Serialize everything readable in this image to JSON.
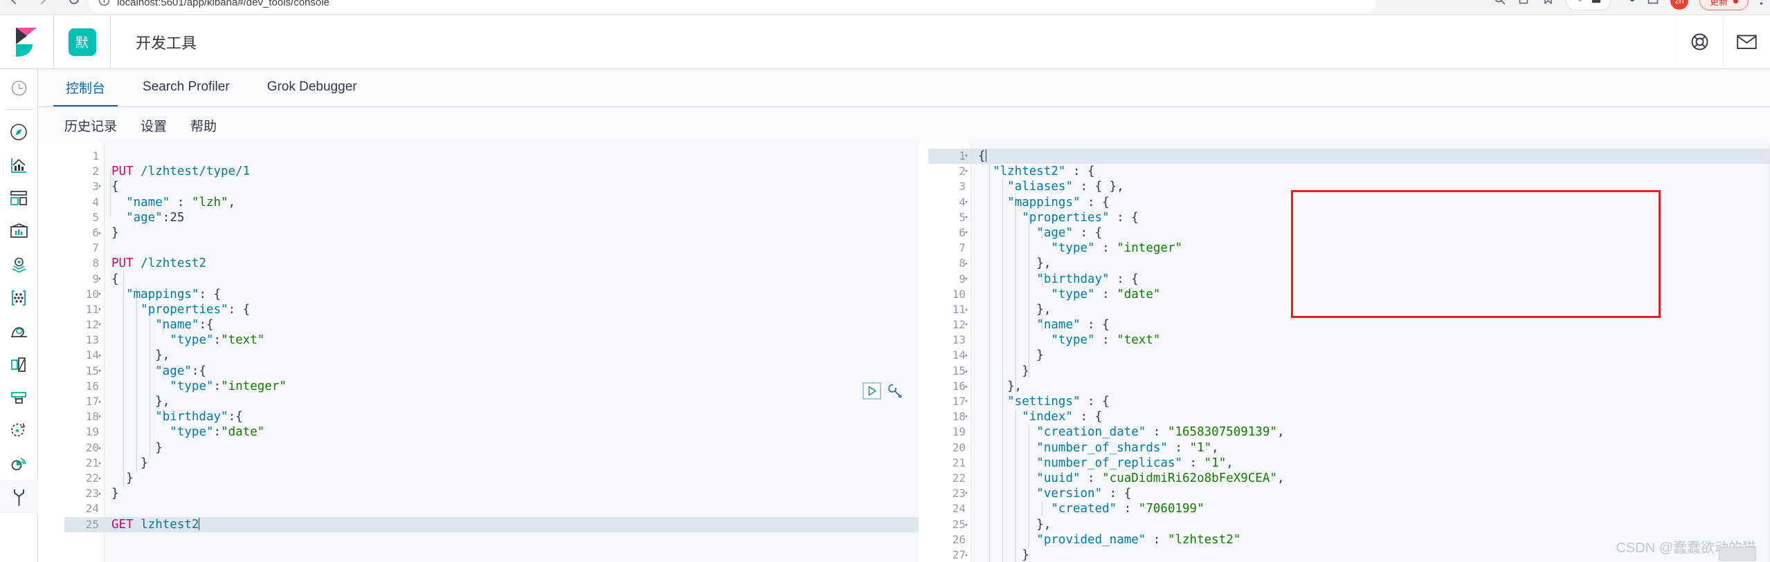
{
  "browser": {
    "url": "localhost:5601/app/kibana#/dev_tools/console",
    "update_label": "更新",
    "profile_initials": "zh",
    "icons": {
      "back": "back-arrow-icon",
      "forward": "forward-arrow-icon",
      "reload": "reload-icon",
      "info": "site-info-icon",
      "search": "search-icon",
      "share": "share-icon",
      "bookmark": "bookmark-icon",
      "download": "download-icon",
      "home": "home-icon",
      "extensions": "extensions-icon",
      "window": "window-icon"
    }
  },
  "kibana": {
    "logo": "kibana-logo",
    "space_badge": "默",
    "app_title": "开发工具",
    "header_icons": [
      "help-ring-icon",
      "mail-icon"
    ]
  },
  "rail": {
    "items": [
      {
        "name": "recently-viewed",
        "icon": "clock-icon",
        "active": false
      },
      {
        "name": "discover",
        "icon": "compass-icon",
        "active": false
      },
      {
        "name": "visualize",
        "icon": "bar-chart-icon",
        "active": false
      },
      {
        "name": "dashboard",
        "icon": "dashboard-icon",
        "active": false
      },
      {
        "name": "canvas",
        "icon": "canvas-icon",
        "active": false
      },
      {
        "name": "maps",
        "icon": "map-pin-layers-icon",
        "active": false
      },
      {
        "name": "graph",
        "icon": "graph-nodes-icon",
        "active": false
      },
      {
        "name": "machine-learning",
        "icon": "machine-learning-icon",
        "active": false
      },
      {
        "name": "apm",
        "icon": "apm-icon",
        "active": false
      },
      {
        "name": "uptime",
        "icon": "uptime-icon",
        "active": false
      },
      {
        "name": "siem",
        "icon": "siem-icon",
        "active": false
      },
      {
        "name": "monitoring",
        "icon": "monitoring-icon",
        "active": false
      },
      {
        "name": "dev-tools",
        "icon": "wrench-icon",
        "active": true
      }
    ]
  },
  "tabs": [
    {
      "label": "控制台",
      "active": true
    },
    {
      "label": "Search Profiler",
      "active": false
    },
    {
      "label": "Grok Debugger",
      "active": false
    }
  ],
  "subbar": [
    {
      "label": "历史记录"
    },
    {
      "label": "设置"
    },
    {
      "label": "帮助"
    }
  ],
  "editor": {
    "current_line": 25,
    "lines": [
      {
        "n": 1,
        "fold": "",
        "tokens": []
      },
      {
        "n": 2,
        "fold": "",
        "tokens": [
          {
            "t": "method",
            "v": "PUT"
          },
          {
            "t": "punct",
            "v": " "
          },
          {
            "t": "url",
            "v": "/lzhtest/type/1"
          }
        ]
      },
      {
        "n": 3,
        "fold": "▾",
        "tokens": [
          {
            "t": "punct",
            "v": "{"
          }
        ]
      },
      {
        "n": 4,
        "fold": "",
        "tokens": [
          {
            "t": "punct",
            "v": "  "
          },
          {
            "t": "key",
            "v": "\"name\""
          },
          {
            "t": "punct",
            "v": " : "
          },
          {
            "t": "str",
            "v": "\"lzh\""
          },
          {
            "t": "punct",
            "v": ","
          }
        ]
      },
      {
        "n": 5,
        "fold": "",
        "tokens": [
          {
            "t": "punct",
            "v": "  "
          },
          {
            "t": "key",
            "v": "\"age\""
          },
          {
            "t": "punct",
            "v": ":"
          },
          {
            "t": "num",
            "v": "25"
          }
        ]
      },
      {
        "n": 6,
        "fold": "▴",
        "tokens": [
          {
            "t": "punct",
            "v": "}"
          }
        ]
      },
      {
        "n": 7,
        "fold": "",
        "tokens": []
      },
      {
        "n": 8,
        "fold": "",
        "tokens": [
          {
            "t": "method",
            "v": "PUT"
          },
          {
            "t": "punct",
            "v": " "
          },
          {
            "t": "url",
            "v": "/lzhtest2"
          }
        ]
      },
      {
        "n": 9,
        "fold": "▾",
        "tokens": [
          {
            "t": "punct",
            "v": "{"
          }
        ]
      },
      {
        "n": 10,
        "fold": "▾",
        "tokens": [
          {
            "t": "punct",
            "v": "  "
          },
          {
            "t": "key",
            "v": "\"mappings\""
          },
          {
            "t": "punct",
            "v": ": {"
          }
        ]
      },
      {
        "n": 11,
        "fold": "▾",
        "tokens": [
          {
            "t": "punct",
            "v": "    "
          },
          {
            "t": "key",
            "v": "\"properties\""
          },
          {
            "t": "punct",
            "v": ": {"
          }
        ]
      },
      {
        "n": 12,
        "fold": "▾",
        "tokens": [
          {
            "t": "punct",
            "v": "      "
          },
          {
            "t": "key",
            "v": "\"name\""
          },
          {
            "t": "punct",
            "v": ":{"
          }
        ]
      },
      {
        "n": 13,
        "fold": "",
        "tokens": [
          {
            "t": "punct",
            "v": "        "
          },
          {
            "t": "key",
            "v": "\"type\""
          },
          {
            "t": "punct",
            "v": ":"
          },
          {
            "t": "str",
            "v": "\"text\""
          }
        ]
      },
      {
        "n": 14,
        "fold": "▴",
        "tokens": [
          {
            "t": "punct",
            "v": "      },"
          }
        ]
      },
      {
        "n": 15,
        "fold": "▾",
        "tokens": [
          {
            "t": "punct",
            "v": "      "
          },
          {
            "t": "key",
            "v": "\"age\""
          },
          {
            "t": "punct",
            "v": ":{"
          }
        ]
      },
      {
        "n": 16,
        "fold": "",
        "tokens": [
          {
            "t": "punct",
            "v": "        "
          },
          {
            "t": "key",
            "v": "\"type\""
          },
          {
            "t": "punct",
            "v": ":"
          },
          {
            "t": "str",
            "v": "\"integer\""
          }
        ]
      },
      {
        "n": 17,
        "fold": "▴",
        "tokens": [
          {
            "t": "punct",
            "v": "      },"
          }
        ]
      },
      {
        "n": 18,
        "fold": "▾",
        "tokens": [
          {
            "t": "punct",
            "v": "      "
          },
          {
            "t": "key",
            "v": "\"birthday\""
          },
          {
            "t": "punct",
            "v": ":{"
          }
        ]
      },
      {
        "n": 19,
        "fold": "",
        "tokens": [
          {
            "t": "punct",
            "v": "        "
          },
          {
            "t": "key",
            "v": "\"type\""
          },
          {
            "t": "punct",
            "v": ":"
          },
          {
            "t": "str",
            "v": "\"date\""
          }
        ]
      },
      {
        "n": 20,
        "fold": "▴",
        "tokens": [
          {
            "t": "punct",
            "v": "      }"
          }
        ]
      },
      {
        "n": 21,
        "fold": "▴",
        "tokens": [
          {
            "t": "punct",
            "v": "    }"
          }
        ]
      },
      {
        "n": 22,
        "fold": "▴",
        "tokens": [
          {
            "t": "punct",
            "v": "  }"
          }
        ]
      },
      {
        "n": 23,
        "fold": "▴",
        "tokens": [
          {
            "t": "punct",
            "v": "}"
          }
        ]
      },
      {
        "n": 24,
        "fold": "",
        "tokens": []
      },
      {
        "n": 25,
        "fold": "",
        "tokens": [
          {
            "t": "method",
            "v": "GET"
          },
          {
            "t": "punct",
            "v": " "
          },
          {
            "t": "url",
            "v": "lzhtest2"
          }
        ],
        "cursor": true
      }
    ]
  },
  "response": {
    "current_line": 1,
    "lines": [
      {
        "n": 1,
        "fold": "▾",
        "tokens": [
          {
            "t": "punct",
            "v": "{"
          }
        ],
        "cursor": true
      },
      {
        "n": 2,
        "fold": "▾",
        "tokens": [
          {
            "t": "punct",
            "v": "  "
          },
          {
            "t": "key",
            "v": "\"lzhtest2\""
          },
          {
            "t": "punct",
            "v": " : {"
          }
        ]
      },
      {
        "n": 3,
        "fold": "",
        "tokens": [
          {
            "t": "punct",
            "v": "    "
          },
          {
            "t": "key",
            "v": "\"aliases\""
          },
          {
            "t": "punct",
            "v": " : { },"
          }
        ]
      },
      {
        "n": 4,
        "fold": "▾",
        "tokens": [
          {
            "t": "punct",
            "v": "    "
          },
          {
            "t": "key",
            "v": "\"mappings\""
          },
          {
            "t": "punct",
            "v": " : {"
          }
        ]
      },
      {
        "n": 5,
        "fold": "▾",
        "tokens": [
          {
            "t": "punct",
            "v": "      "
          },
          {
            "t": "key",
            "v": "\"properties\""
          },
          {
            "t": "punct",
            "v": " : {"
          }
        ]
      },
      {
        "n": 6,
        "fold": "▾",
        "tokens": [
          {
            "t": "punct",
            "v": "        "
          },
          {
            "t": "key",
            "v": "\"age\""
          },
          {
            "t": "punct",
            "v": " : {"
          }
        ]
      },
      {
        "n": 7,
        "fold": "",
        "tokens": [
          {
            "t": "punct",
            "v": "          "
          },
          {
            "t": "key",
            "v": "\"type\""
          },
          {
            "t": "punct",
            "v": " : "
          },
          {
            "t": "str",
            "v": "\"integer\""
          }
        ]
      },
      {
        "n": 8,
        "fold": "▴",
        "tokens": [
          {
            "t": "punct",
            "v": "        },"
          }
        ]
      },
      {
        "n": 9,
        "fold": "▾",
        "tokens": [
          {
            "t": "punct",
            "v": "        "
          },
          {
            "t": "key",
            "v": "\"birthday\""
          },
          {
            "t": "punct",
            "v": " : {"
          }
        ]
      },
      {
        "n": 10,
        "fold": "",
        "tokens": [
          {
            "t": "punct",
            "v": "          "
          },
          {
            "t": "key",
            "v": "\"type\""
          },
          {
            "t": "punct",
            "v": " : "
          },
          {
            "t": "str",
            "v": "\"date\""
          }
        ]
      },
      {
        "n": 11,
        "fold": "▴",
        "tokens": [
          {
            "t": "punct",
            "v": "        },"
          }
        ]
      },
      {
        "n": 12,
        "fold": "▾",
        "tokens": [
          {
            "t": "punct",
            "v": "        "
          },
          {
            "t": "key",
            "v": "\"name\""
          },
          {
            "t": "punct",
            "v": " : {"
          }
        ]
      },
      {
        "n": 13,
        "fold": "",
        "tokens": [
          {
            "t": "punct",
            "v": "          "
          },
          {
            "t": "key",
            "v": "\"type\""
          },
          {
            "t": "punct",
            "v": " : "
          },
          {
            "t": "str",
            "v": "\"text\""
          }
        ]
      },
      {
        "n": 14,
        "fold": "▴",
        "tokens": [
          {
            "t": "punct",
            "v": "        }"
          }
        ]
      },
      {
        "n": 15,
        "fold": "▴",
        "tokens": [
          {
            "t": "punct",
            "v": "      }"
          }
        ]
      },
      {
        "n": 16,
        "fold": "▴",
        "tokens": [
          {
            "t": "punct",
            "v": "    },"
          }
        ]
      },
      {
        "n": 17,
        "fold": "▾",
        "tokens": [
          {
            "t": "punct",
            "v": "    "
          },
          {
            "t": "key",
            "v": "\"settings\""
          },
          {
            "t": "punct",
            "v": " : {"
          }
        ]
      },
      {
        "n": 18,
        "fold": "▾",
        "tokens": [
          {
            "t": "punct",
            "v": "      "
          },
          {
            "t": "key",
            "v": "\"index\""
          },
          {
            "t": "punct",
            "v": " : {"
          }
        ]
      },
      {
        "n": 19,
        "fold": "",
        "tokens": [
          {
            "t": "punct",
            "v": "        "
          },
          {
            "t": "key",
            "v": "\"creation_date\""
          },
          {
            "t": "punct",
            "v": " : "
          },
          {
            "t": "str",
            "v": "\"1658307509139\""
          },
          {
            "t": "punct",
            "v": ","
          }
        ]
      },
      {
        "n": 20,
        "fold": "",
        "tokens": [
          {
            "t": "punct",
            "v": "        "
          },
          {
            "t": "key",
            "v": "\"number_of_shards\""
          },
          {
            "t": "punct",
            "v": " : "
          },
          {
            "t": "str",
            "v": "\"1\""
          },
          {
            "t": "punct",
            "v": ","
          }
        ]
      },
      {
        "n": 21,
        "fold": "",
        "tokens": [
          {
            "t": "punct",
            "v": "        "
          },
          {
            "t": "key",
            "v": "\"number_of_replicas\""
          },
          {
            "t": "punct",
            "v": " : "
          },
          {
            "t": "str",
            "v": "\"1\""
          },
          {
            "t": "punct",
            "v": ","
          }
        ]
      },
      {
        "n": 22,
        "fold": "",
        "tokens": [
          {
            "t": "punct",
            "v": "        "
          },
          {
            "t": "key",
            "v": "\"uuid\""
          },
          {
            "t": "punct",
            "v": " : "
          },
          {
            "t": "str",
            "v": "\"cuaDidmiRi62o8bFeX9CEA\""
          },
          {
            "t": "punct",
            "v": ","
          }
        ]
      },
      {
        "n": 23,
        "fold": "▾",
        "tokens": [
          {
            "t": "punct",
            "v": "        "
          },
          {
            "t": "key",
            "v": "\"version\""
          },
          {
            "t": "punct",
            "v": " : {"
          }
        ]
      },
      {
        "n": 24,
        "fold": "",
        "tokens": [
          {
            "t": "punct",
            "v": "          "
          },
          {
            "t": "key",
            "v": "\"created\""
          },
          {
            "t": "punct",
            "v": " : "
          },
          {
            "t": "str",
            "v": "\"7060199\""
          }
        ]
      },
      {
        "n": 25,
        "fold": "▴",
        "tokens": [
          {
            "t": "punct",
            "v": "        },"
          }
        ]
      },
      {
        "n": 26,
        "fold": "",
        "tokens": [
          {
            "t": "punct",
            "v": "        "
          },
          {
            "t": "key",
            "v": "\"provided_name\""
          },
          {
            "t": "punct",
            "v": " : "
          },
          {
            "t": "str",
            "v": "\"lzhtest2\""
          }
        ]
      },
      {
        "n": 27,
        "fold": "▴",
        "tokens": [
          {
            "t": "punct",
            "v": "      }"
          }
        ]
      }
    ]
  },
  "annotation": {
    "color": "#e8211c",
    "label": "mappings-highlight-box"
  },
  "run_controls": {
    "play": "play-triangle-icon",
    "wrench": "wrench-icon"
  },
  "watermark": {
    "text": "CSDN @蠢蠢欲动的猫"
  },
  "colors": {
    "accent": "#006bb4",
    "teal": "#00bfb3",
    "annotation_red": "#e8211c",
    "method": "#d1006b",
    "string": "#137b00",
    "key": "#0079a5"
  }
}
